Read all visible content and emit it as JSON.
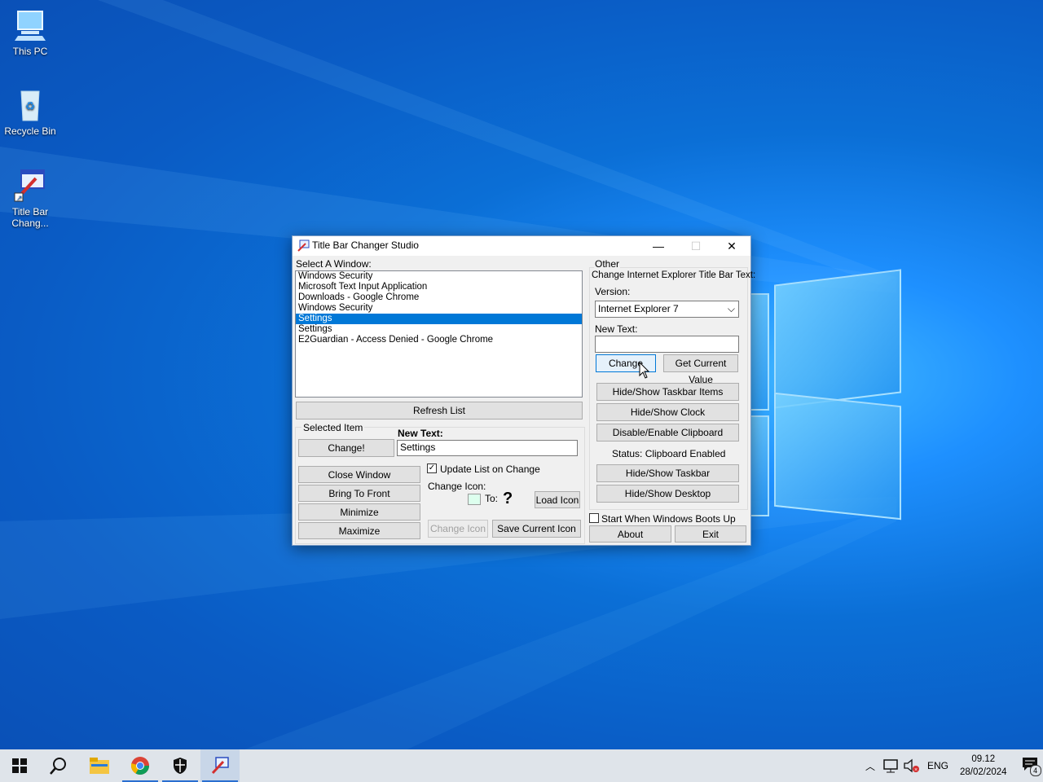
{
  "desktop": {
    "icons": [
      {
        "label": "This PC",
        "icon": "this-pc-icon"
      },
      {
        "label": "Recycle Bin",
        "icon": "recycle-bin-icon"
      },
      {
        "label": "Title Bar Chang...",
        "icon": "title-bar-changer-icon"
      }
    ]
  },
  "window": {
    "title": "Title Bar Changer Studio",
    "select_window_label": "Select A Window:",
    "window_list": [
      "Windows Security",
      "Microsoft Text Input Application",
      "Downloads - Google Chrome",
      "Windows Security",
      "Settings",
      "Settings",
      "E2Guardian - Access Denied - Google Chrome"
    ],
    "selected_index": 4,
    "refresh_list_label": "Refresh List",
    "selected_item_group": "Selected Item",
    "change_button": "Change!",
    "new_text_label": "New Text:",
    "new_text_value": "Settings",
    "close_window": "Close Window",
    "bring_to_front": "Bring To Front",
    "minimize": "Minimize",
    "maximize": "Maximize",
    "update_list_on_change": "Update List on Change",
    "update_list_checked": true,
    "change_icon_label": "Change Icon:",
    "to_label": "To:",
    "load_icon": "Load Icon",
    "change_icon_button": "Change Icon",
    "save_current_icon": "Save Current Icon",
    "other_group": "Other",
    "ie_title_label": "Change Internet Explorer Title Bar Text:",
    "version_label": "Version:",
    "version_value": "Internet Explorer 7",
    "ie_new_text_label": "New Text:",
    "ie_new_text_value": "",
    "ie_change": "Change",
    "get_current_value": "Get Current Value",
    "hide_show_taskbar_items": "Hide/Show Taskbar Items",
    "hide_show_clock": "Hide/Show Clock",
    "disable_enable_clipboard": "Disable/Enable Clipboard",
    "status": "Status: Clipboard Enabled",
    "hide_show_taskbar": "Hide/Show Taskbar",
    "hide_show_desktop": "Hide/Show Desktop",
    "start_when_boots": "Start When Windows Boots Up",
    "start_when_boots_checked": false,
    "about": "About",
    "exit": "Exit"
  },
  "taskbar": {
    "items": [
      "start-icon",
      "search-icon",
      "file-explorer-icon",
      "chrome-icon",
      "windows-security-icon",
      "title-bar-changer-icon"
    ],
    "language": "ENG",
    "time": "09.12",
    "date": "28/02/2024",
    "notification_count": "4"
  }
}
